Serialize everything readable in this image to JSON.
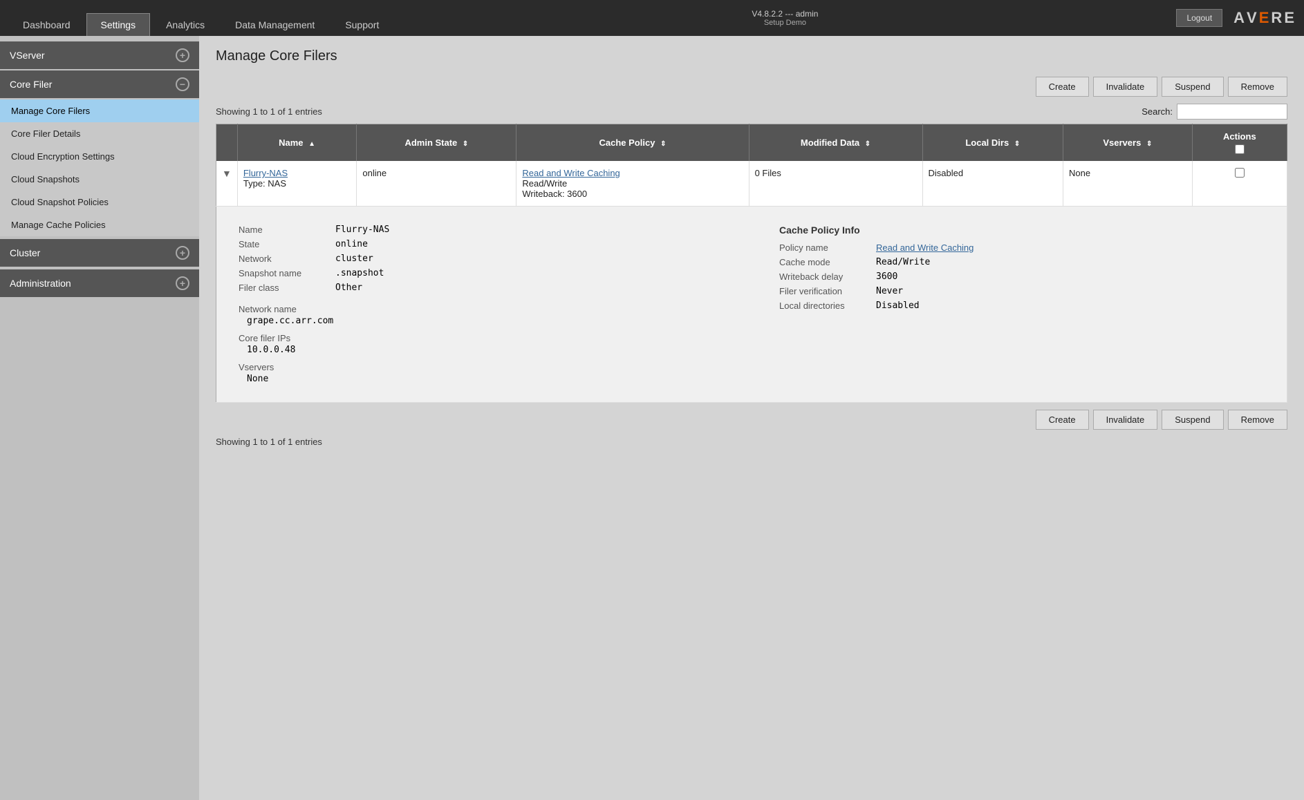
{
  "topbar": {
    "tabs": [
      {
        "id": "dashboard",
        "label": "Dashboard",
        "active": false
      },
      {
        "id": "settings",
        "label": "Settings",
        "active": true
      },
      {
        "id": "analytics",
        "label": "Analytics",
        "active": false
      },
      {
        "id": "data-management",
        "label": "Data Management",
        "active": false
      },
      {
        "id": "support",
        "label": "Support",
        "active": false
      }
    ],
    "version": "V4.8.2.2 --- admin",
    "setup_demo": "Setup Demo",
    "logout_label": "Logout"
  },
  "logo": {
    "text_A": "A",
    "text_V": "V",
    "accent_E": "E",
    "text_R": "R",
    "text_E2": "E"
  },
  "sidebar": {
    "sections": [
      {
        "id": "vserver",
        "label": "VServer",
        "expanded": false,
        "icon": "+",
        "items": []
      },
      {
        "id": "core-filer",
        "label": "Core Filer",
        "expanded": true,
        "icon": "−",
        "items": [
          {
            "id": "manage-core-filers",
            "label": "Manage Core Filers",
            "active": true
          },
          {
            "id": "core-filer-details",
            "label": "Core Filer Details",
            "active": false
          },
          {
            "id": "cloud-encryption-settings",
            "label": "Cloud Encryption Settings",
            "active": false
          },
          {
            "id": "cloud-snapshots",
            "label": "Cloud Snapshots",
            "active": false
          },
          {
            "id": "cloud-snapshot-policies",
            "label": "Cloud Snapshot Policies",
            "active": false
          },
          {
            "id": "manage-cache-policies",
            "label": "Manage Cache Policies",
            "active": false
          }
        ]
      },
      {
        "id": "cluster",
        "label": "Cluster",
        "expanded": false,
        "icon": "+",
        "items": []
      },
      {
        "id": "administration",
        "label": "Administration",
        "expanded": false,
        "icon": "+",
        "items": []
      }
    ]
  },
  "page": {
    "title": "Manage Core Filers",
    "showing_text": "Showing 1 to 1 of 1 entries",
    "showing_text_bottom": "Showing 1 to 1 of 1 entries",
    "search_label": "Search:",
    "search_placeholder": ""
  },
  "toolbar": {
    "create_label": "Create",
    "invalidate_label": "Invalidate",
    "suspend_label": "Suspend",
    "remove_label": "Remove"
  },
  "table": {
    "columns": [
      {
        "id": "expand",
        "label": "",
        "sortable": false
      },
      {
        "id": "name",
        "label": "Name",
        "sortable": true
      },
      {
        "id": "admin-state",
        "label": "Admin State",
        "sortable": true
      },
      {
        "id": "cache-policy",
        "label": "Cache Policy",
        "sortable": true
      },
      {
        "id": "modified-data",
        "label": "Modified Data",
        "sortable": true
      },
      {
        "id": "local-dirs",
        "label": "Local Dirs",
        "sortable": true
      },
      {
        "id": "vservers",
        "label": "Vservers",
        "sortable": true
      },
      {
        "id": "actions",
        "label": "Actions",
        "sortable": false
      }
    ],
    "rows": [
      {
        "id": "flurry-nas",
        "name": "Flurry-NAS",
        "type": "Type: NAS",
        "admin_state": "online",
        "cache_policy_link": "Read and Write Caching",
        "cache_policy_mode": "Read/Write",
        "cache_policy_writeback": "Writeback: 3600",
        "modified_data": "0 Files",
        "local_dirs": "Disabled",
        "vservers": "None",
        "expanded": true
      }
    ],
    "expanded_detail": {
      "name_label": "Name",
      "name_value": "Flurry-NAS",
      "state_label": "State",
      "state_value": "online",
      "network_label": "Network",
      "network_value": "cluster",
      "snapshot_name_label": "Snapshot name",
      "snapshot_name_value": ".snapshot",
      "filer_class_label": "Filer class",
      "filer_class_value": "Other",
      "network_name_label": "Network name",
      "network_name_value": "grape.cc.arr.com",
      "core_filer_ips_label": "Core filer IPs",
      "core_filer_ips_value": "10.0.0.48",
      "vservers_label": "Vservers",
      "vservers_value": "None",
      "cache_policy_info_title": "Cache Policy Info",
      "policy_name_label": "Policy name",
      "policy_name_value": "Read and Write Caching",
      "cache_mode_label": "Cache mode",
      "cache_mode_value": "Read/Write",
      "writeback_delay_label": "Writeback delay",
      "writeback_delay_value": "3600",
      "filer_verification_label": "Filer verification",
      "filer_verification_value": "Never",
      "local_directories_label": "Local directories",
      "local_directories_value": "Disabled"
    }
  }
}
